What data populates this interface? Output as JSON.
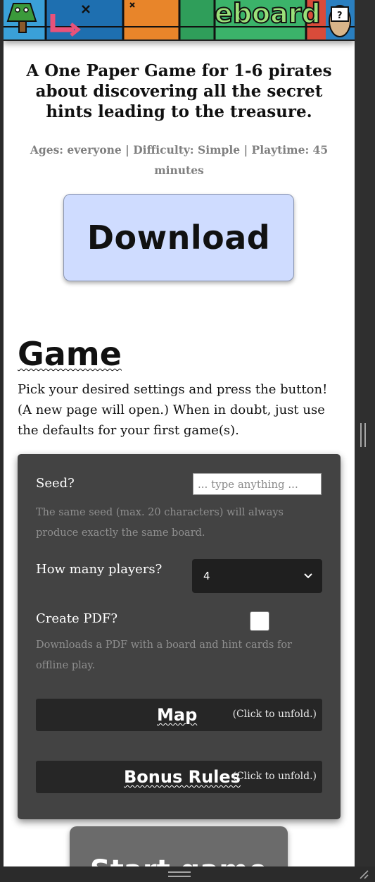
{
  "colors": {
    "download_bg": "#cfdcff",
    "panel_bg": "#434343",
    "select_bg": "#1f1f1f",
    "fold_bar_bg": "#262626",
    "start_button_bg": "#6b6b6b",
    "chrome": "#2b2b2b"
  },
  "banner": {
    "image_text": "...eboard",
    "icons": [
      "tree-icon",
      "arrow-icon",
      "pirate-icon"
    ]
  },
  "header": {
    "tagline": "A One Paper Game for 1-6 pirates about discovering all the secret hints leading to the treasure.",
    "meta": "Ages: everyone | Difficulty: Simple | Playtime: 45 minutes"
  },
  "download": {
    "label": "Download"
  },
  "game": {
    "heading": "Game",
    "intro": "Pick your desired settings and press the button! (A new page will open.) When in doubt, just use the defaults for your first game(s)."
  },
  "settings": {
    "seed": {
      "label": "Seed?",
      "placeholder": "... type anything ...",
      "value": "",
      "help": "The same seed (max. 20 characters) will always produce exactly the same board."
    },
    "players": {
      "label": "How many players?",
      "selected": "4"
    },
    "pdf": {
      "label": "Create PDF?",
      "checked": false,
      "help": "Downloads a PDF with a board and hint cards for offline play."
    },
    "sections": [
      {
        "title": "Map",
        "hint": "(Click to unfold.)"
      },
      {
        "title": "Bonus Rules",
        "hint": "(Click to unfold.)"
      }
    ]
  },
  "start": {
    "label": "Start game"
  }
}
